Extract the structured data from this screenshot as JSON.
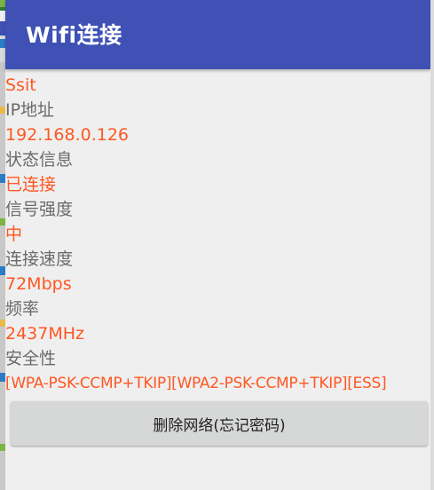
{
  "app": {
    "title": "Wifi连接",
    "accent_color": "#3f51b5",
    "value_color": "#ff5722"
  },
  "details": [
    {
      "type": "value",
      "text": "Ssit"
    },
    {
      "type": "label",
      "text": "IP地址"
    },
    {
      "type": "value",
      "text": "192.168.0.126"
    },
    {
      "type": "label",
      "text": "状态信息"
    },
    {
      "type": "value",
      "text": "已连接"
    },
    {
      "type": "label",
      "text": "信号强度"
    },
    {
      "type": "value",
      "text": "中"
    },
    {
      "type": "label",
      "text": "连接速度"
    },
    {
      "type": "value",
      "text": "72Mbps"
    },
    {
      "type": "label",
      "text": "频率"
    },
    {
      "type": "value",
      "text": "2437MHz"
    },
    {
      "type": "label",
      "text": "安全性"
    },
    {
      "type": "value",
      "text": "[WPA-PSK-CCMP+TKIP][WPA2-PSK-CCMP+TKIP][ESS]"
    }
  ],
  "actions": {
    "forget_network_label": "删除网络(忘记密码)"
  }
}
